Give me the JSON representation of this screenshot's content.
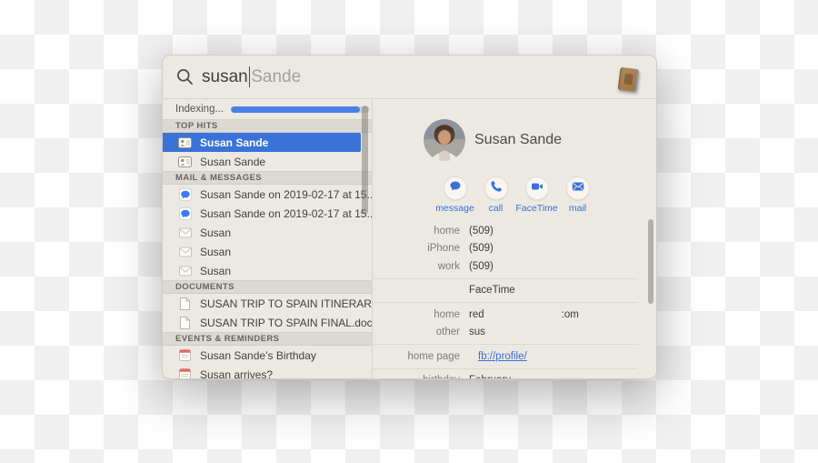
{
  "search": {
    "typed": "susan",
    "completion": "Sande",
    "icons": {
      "left": "search-icon",
      "right": "contacts-app-icon"
    }
  },
  "sidebar": {
    "indexing": {
      "label": "Indexing...",
      "progress_percent": 93
    },
    "sections": [
      {
        "header": "TOP HITS",
        "items": [
          {
            "icon": "contact-card",
            "label": "Susan Sande",
            "selected": true
          },
          {
            "icon": "contact-card",
            "label": "Susan Sande",
            "selected": false
          }
        ]
      },
      {
        "header": "MAIL & MESSAGES",
        "items": [
          {
            "icon": "imessage",
            "label": "Susan Sande on 2019-02-17 at 15....",
            "selected": false
          },
          {
            "icon": "imessage",
            "label": "Susan Sande on 2019-02-17 at 15....",
            "selected": false
          },
          {
            "icon": "envelope",
            "label": "Susan",
            "selected": false
          },
          {
            "icon": "envelope",
            "label": "Susan",
            "selected": false
          },
          {
            "icon": "envelope",
            "label": "Susan",
            "selected": false
          }
        ]
      },
      {
        "header": "DOCUMENTS",
        "items": [
          {
            "icon": "document",
            "label": "SUSAN TRIP TO SPAIN ITINERARY....",
            "selected": false
          },
          {
            "icon": "document",
            "label": "SUSAN TRIP TO SPAIN FINAL.docx",
            "selected": false
          }
        ]
      },
      {
        "header": "EVENTS & REMINDERS",
        "items": [
          {
            "icon": "calendar",
            "label": "Susan Sande’s Birthday",
            "selected": false
          },
          {
            "icon": "calendar",
            "label": "Susan arrives?",
            "selected": false
          }
        ]
      }
    ]
  },
  "detail": {
    "name": "Susan Sande",
    "avatar": "photo-of-susan",
    "actions": [
      {
        "icon": "message-bubble",
        "label": "message"
      },
      {
        "icon": "phone",
        "label": "call"
      },
      {
        "icon": "video-camera",
        "label": "FaceTime"
      },
      {
        "icon": "mail-envelope",
        "label": "mail"
      }
    ],
    "fields": [
      {
        "type": "row",
        "label": "home",
        "value": "(509)"
      },
      {
        "type": "row",
        "label": "iPhone",
        "value": "(509)"
      },
      {
        "type": "row",
        "label": "work",
        "value": "(509)"
      },
      {
        "type": "separator"
      },
      {
        "type": "row",
        "label": "",
        "value": "FaceTime"
      },
      {
        "type": "separator"
      },
      {
        "type": "row",
        "label": "home",
        "value": "red",
        "value_right": ":om"
      },
      {
        "type": "row",
        "label": "other",
        "value": "sus"
      },
      {
        "type": "separator"
      },
      {
        "type": "row",
        "label": "home page",
        "value": "fb://profile/",
        "link": true
      },
      {
        "type": "separator"
      },
      {
        "type": "row",
        "label": "birthday",
        "value": "February"
      }
    ]
  },
  "colors": {
    "window_bg": "#ece9e3",
    "selection_blue": "#3a72d8",
    "progress_blue": "#4b80e9",
    "accent_blue": "#3b6ed6",
    "link_blue": "#3b6ed6"
  }
}
